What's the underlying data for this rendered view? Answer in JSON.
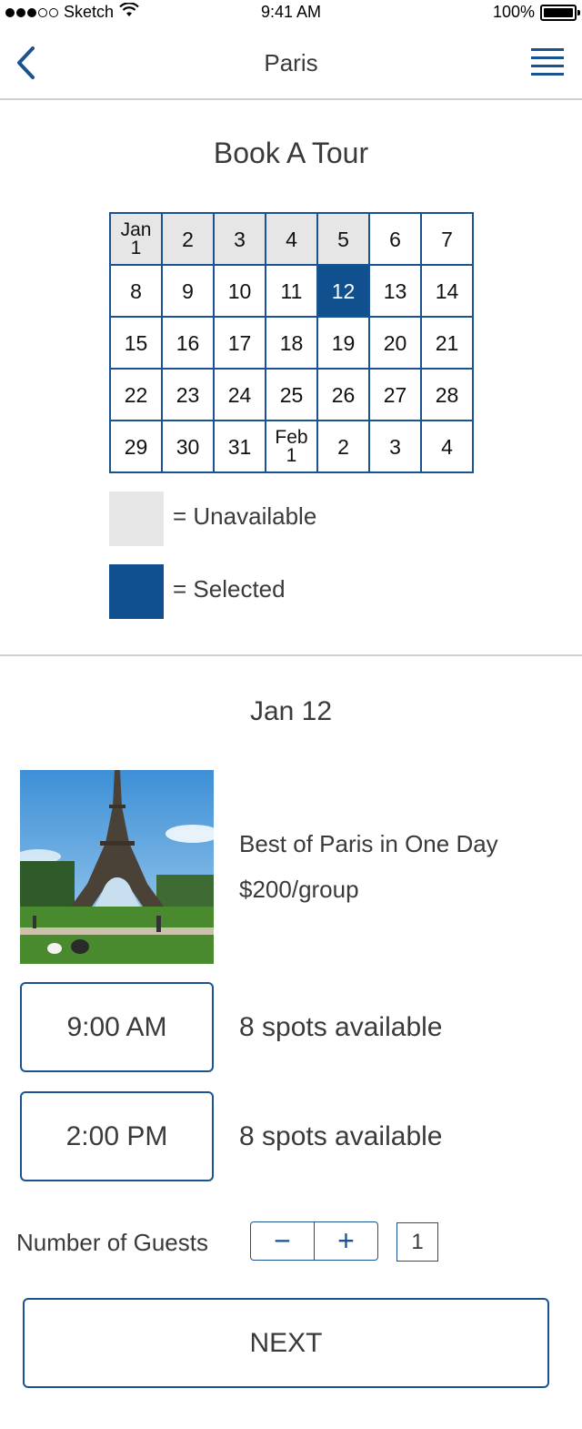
{
  "status_bar": {
    "carrier": "Sketch",
    "time": "9:41 AM",
    "battery": "100%"
  },
  "nav": {
    "title": "Paris"
  },
  "booking": {
    "title": "Book A Tour",
    "calendar": [
      {
        "label": "Jan\n1",
        "state": "unavailable"
      },
      {
        "label": "2",
        "state": "unavailable"
      },
      {
        "label": "3",
        "state": "unavailable"
      },
      {
        "label": "4",
        "state": "unavailable"
      },
      {
        "label": "5",
        "state": "unavailable"
      },
      {
        "label": "6",
        "state": "available"
      },
      {
        "label": "7",
        "state": "available"
      },
      {
        "label": "8",
        "state": "available"
      },
      {
        "label": "9",
        "state": "available"
      },
      {
        "label": "10",
        "state": "available"
      },
      {
        "label": "11",
        "state": "available"
      },
      {
        "label": "12",
        "state": "selected"
      },
      {
        "label": "13",
        "state": "available"
      },
      {
        "label": "14",
        "state": "available"
      },
      {
        "label": "15",
        "state": "available"
      },
      {
        "label": "16",
        "state": "available"
      },
      {
        "label": "17",
        "state": "available"
      },
      {
        "label": "18",
        "state": "available"
      },
      {
        "label": "19",
        "state": "available"
      },
      {
        "label": "20",
        "state": "available"
      },
      {
        "label": "21",
        "state": "available"
      },
      {
        "label": "22",
        "state": "available"
      },
      {
        "label": "23",
        "state": "available"
      },
      {
        "label": "24",
        "state": "available"
      },
      {
        "label": "25",
        "state": "available"
      },
      {
        "label": "26",
        "state": "available"
      },
      {
        "label": "27",
        "state": "available"
      },
      {
        "label": "28",
        "state": "available"
      },
      {
        "label": "29",
        "state": "available"
      },
      {
        "label": "30",
        "state": "available"
      },
      {
        "label": "31",
        "state": "available"
      },
      {
        "label": "Feb\n1",
        "state": "available"
      },
      {
        "label": "2",
        "state": "available"
      },
      {
        "label": "3",
        "state": "available"
      },
      {
        "label": "4",
        "state": "available"
      }
    ],
    "legend": {
      "unavailable": "= Unavailable",
      "selected": "= Selected"
    }
  },
  "tour": {
    "date": "Jan 12",
    "name": "Best of Paris in One Day",
    "price": "$200/group",
    "times": [
      {
        "time": "9:00 AM",
        "spots": "8 spots available"
      },
      {
        "time": "2:00 PM",
        "spots": "8 spots available"
      }
    ],
    "guests_label": "Number of Guests",
    "minus": "−",
    "plus": "+",
    "guest_count": "1",
    "next": "NEXT"
  },
  "colors": {
    "accent": "#1a5390",
    "selected": "#10508f",
    "unavailable": "#e6e6e6",
    "divider": "#d0d0d0",
    "text": "#3a3a3a"
  }
}
